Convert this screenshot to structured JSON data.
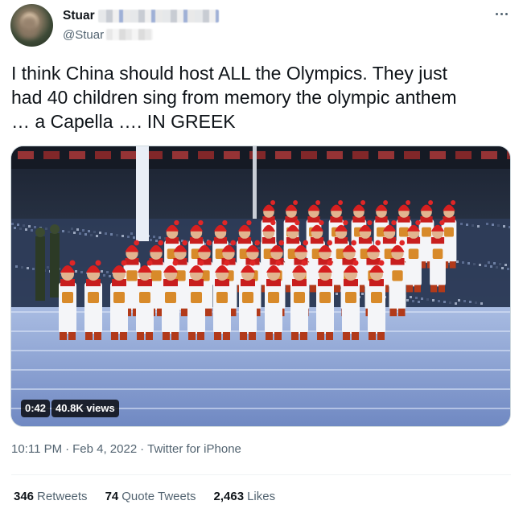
{
  "author": {
    "display_name": "Stuar",
    "handle": "@Stuar"
  },
  "tweet": {
    "text": "I think China should host ALL the Olympics.  They just\nhad 40 children sing from memory the olympic anthem\n… a Capella …. IN GREEK"
  },
  "video": {
    "duration": "0:42",
    "views": "40.8K views"
  },
  "meta": {
    "time": "10:11 PM",
    "separator": "·",
    "date": "Feb 4, 2022",
    "source": "Twitter for iPhone"
  },
  "stats": {
    "retweets_count": "346",
    "retweets_label": "Retweets",
    "quotes_count": "74",
    "quotes_label": "Quote Tweets",
    "likes_count": "2,463",
    "likes_label": "Likes"
  },
  "colors": {
    "text_primary": "#0f1419",
    "text_secondary": "#536471",
    "border": "#cfd9de"
  },
  "icons": {
    "more": "more-dots-icon"
  }
}
